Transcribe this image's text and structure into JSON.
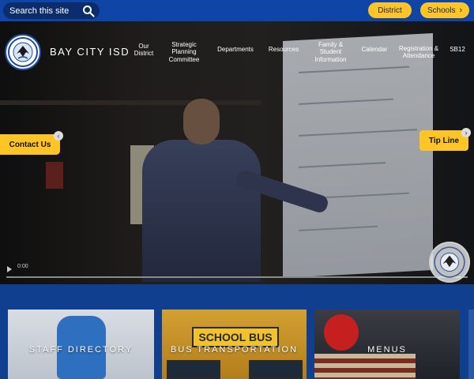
{
  "search": {
    "placeholder": "Search this site"
  },
  "utility": {
    "district_label": "District",
    "schools_label": "Schools"
  },
  "site": {
    "title": "BAY CITY ISD"
  },
  "nav": [
    {
      "label": "Our District"
    },
    {
      "label": "Strategic Planning Committee"
    },
    {
      "label": "Departments"
    },
    {
      "label": "Resources"
    },
    {
      "label": "Family & Student Information"
    },
    {
      "label": "Calendar"
    },
    {
      "label": "Registration & Attendance"
    },
    {
      "label": "SB12"
    }
  ],
  "hero": {
    "contact_label": "Contact Us",
    "tipline_label": "Tip Line",
    "video_time": "0:00"
  },
  "cards": [
    {
      "label": "STAFF DIRECTORY",
      "sign": ""
    },
    {
      "label": "BUS TRANSPORTATION",
      "sign": "SCHOOL BUS"
    },
    {
      "label": "MENUS",
      "sign": ""
    }
  ],
  "colors": {
    "brand_blue": "#1045a8",
    "accent_yellow": "#ffc425"
  },
  "icons": {
    "search": "search-icon",
    "chevron": "chevron-right-icon"
  }
}
